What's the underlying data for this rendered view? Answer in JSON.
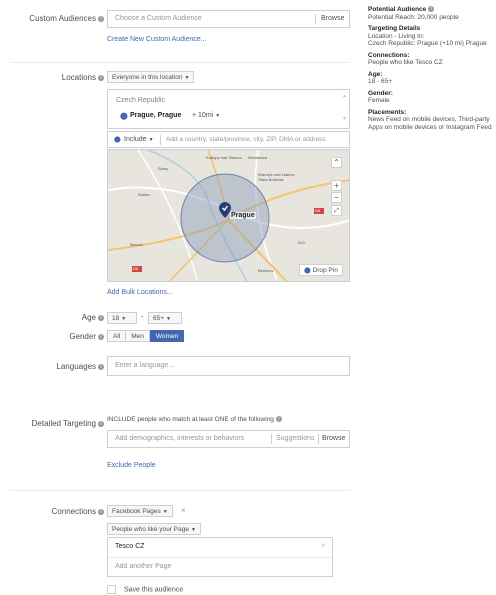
{
  "custom_audiences": {
    "label": "Custom Audiences",
    "placeholder": "Choose a Custom Audience",
    "browse": "Browse",
    "create_link": "Create New Custom Audience..."
  },
  "locations": {
    "label": "Locations",
    "mode": "Everyone in this location",
    "country": "Czech Republic",
    "city": "Prague, Prague",
    "radius": "+ 10mi",
    "include": "Include",
    "add_placeholder": "Add a country, state/province, city, ZIP, DMA or address",
    "map_center_label": "Prague",
    "drop_pin": "Drop Pin",
    "add_bulk": "Add Bulk Locations...",
    "map_labels": [
      "Kralupy nad Vltavou",
      "Neratovice",
      "Brandys nad Labem-Stara Boleslav",
      "Slany",
      "Kladno",
      "Beroun",
      "Benesov",
      "D8",
      "D11",
      "D5"
    ]
  },
  "age": {
    "label": "Age",
    "min": "18",
    "max": "65+",
    "sep": "-"
  },
  "gender": {
    "label": "Gender",
    "options": [
      "All",
      "Men",
      "Women"
    ],
    "selected": "Women"
  },
  "languages": {
    "label": "Languages",
    "placeholder": "Enter a language..."
  },
  "detailed_targeting": {
    "label": "Detailed Targeting",
    "include_text": "INCLUDE people who match at least ONE of the following",
    "placeholder": "Add demographics, interests or behaviors",
    "suggestions": "Suggestions",
    "browse": "Browse",
    "exclude_link": "Exclude People"
  },
  "connections": {
    "label": "Connections",
    "type": "Facebook Pages",
    "remove": "×",
    "subtype": "People who like your Page",
    "page": "Tesco CZ",
    "page_remove": "×",
    "add_placeholder": "Add another Page",
    "save_label": "Save this audience"
  },
  "summary": {
    "potential_title": "Potential Audience",
    "potential_reach": "Potential Reach: 20,000 people",
    "targeting_title": "Targeting Details",
    "location_title": "Location - Living In:",
    "location_value": "Czech Republic: Prague (+10 mi) Prague",
    "connections_title": "Connections:",
    "connections_value": "People who like Tesco CZ",
    "age_title": "Age:",
    "age_value": "18 - 65+",
    "gender_title": "Gender:",
    "gender_value": "Female",
    "placements_title": "Placements:",
    "placements_value_1": "News Feed on mobile devices, Third-party",
    "placements_value_2": "Apps on mobile devices or Instagram Feed"
  },
  "colors": {
    "accent": "#4267b2",
    "pin": "#283e7a",
    "radius_fill": "#8a9bb8"
  }
}
